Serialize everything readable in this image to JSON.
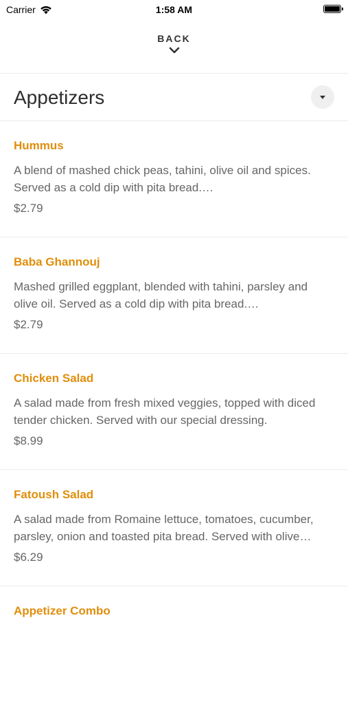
{
  "status_bar": {
    "carrier": "Carrier",
    "time": "1:58 AM"
  },
  "nav": {
    "back_label": "BACK"
  },
  "section": {
    "title": "Appetizers"
  },
  "items": [
    {
      "name": "Hummus",
      "description": "A blend of mashed chick peas, tahini, olive oil and spices. Served as a cold dip with pita bread.…",
      "price": "$2.79"
    },
    {
      "name": "Baba Ghannouj",
      "description": "Mashed grilled eggplant, blended with tahini, parsley and olive oil. Served as a cold dip with pita bread.…",
      "price": "$2.79"
    },
    {
      "name": "Chicken Salad",
      "description": "A salad made from fresh mixed veggies, topped with diced tender chicken. Served with our special dressing.",
      "price": "$8.99"
    },
    {
      "name": "Fatoush Salad",
      "description": "A salad made from Romaine lettuce, tomatoes, cucumber, parsley, onion and toasted pita bread. Served with olive…",
      "price": "$6.29"
    },
    {
      "name": "Appetizer Combo",
      "description": "",
      "price": ""
    }
  ],
  "colors": {
    "accent": "#e08e0b",
    "text_muted": "#666666",
    "divider": "#ececec"
  }
}
